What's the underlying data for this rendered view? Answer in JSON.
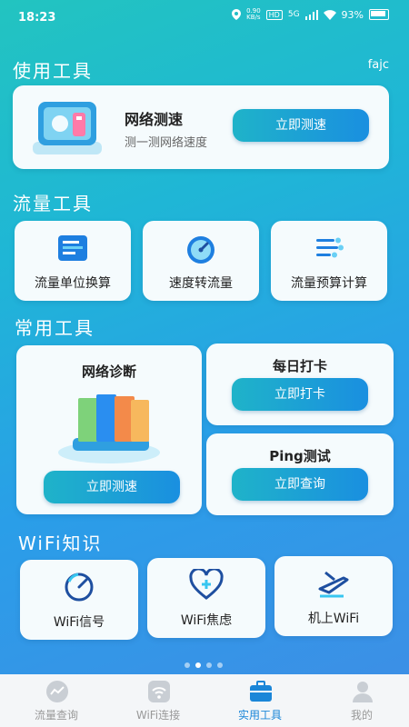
{
  "status": {
    "time": "18:23",
    "speed": "0.90",
    "speed_unit": "KB/s",
    "hd": "HD",
    "net": "5G",
    "battery": "93%"
  },
  "user_tag": "fajc",
  "sections": {
    "use_tools": "使用工具",
    "flow_tools": "流量工具",
    "common_tools": "常用工具",
    "wifi_knowledge": "WiFi知识"
  },
  "speed_card": {
    "title": "网络测速",
    "subtitle": "测一测网络速度",
    "button": "立即测速"
  },
  "flow_tools": [
    {
      "label": "流量单位换算",
      "icon": "list-convert-icon"
    },
    {
      "label": "速度转流量",
      "icon": "speedometer-icon"
    },
    {
      "label": "流量预算计算",
      "icon": "flow-budget-icon"
    }
  ],
  "common_tools": {
    "diagnose": {
      "title": "网络诊断",
      "button": "立即测速"
    },
    "checkin": {
      "title": "每日打卡",
      "button": "立即打卡"
    },
    "ping": {
      "title": "Ping测试",
      "button": "立即查询"
    }
  },
  "wifi_items": [
    {
      "label": "WiFi信号",
      "icon": "signal-gauge-icon"
    },
    {
      "label": "WiFi焦虑",
      "icon": "heart-plus-icon"
    },
    {
      "label": "机上WiFi",
      "icon": "airplane-icon"
    }
  ],
  "tabs": [
    {
      "label": "流量查询",
      "icon": "chart-circle-icon",
      "active": false
    },
    {
      "label": "WiFi连接",
      "icon": "wifi-icon",
      "active": false
    },
    {
      "label": "实用工具",
      "icon": "toolbox-icon",
      "active": true
    },
    {
      "label": "我的",
      "icon": "person-icon",
      "active": false
    }
  ],
  "colors": {
    "accent": "#1b86d8",
    "button_start": "#1fb3c9",
    "button_end": "#1a8fe0"
  }
}
